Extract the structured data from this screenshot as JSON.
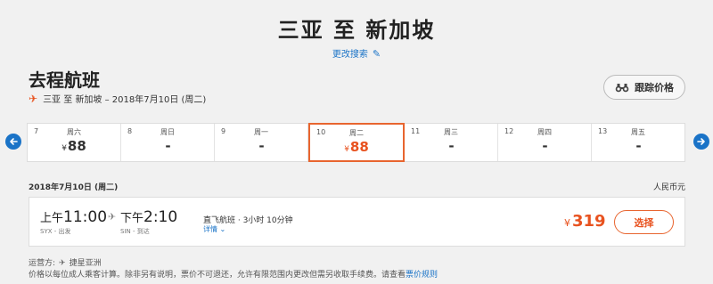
{
  "route": {
    "title": "三亚 至 新加坡",
    "edit_search": "更改搜索"
  },
  "section": {
    "title": "去程航班",
    "from": "三亚",
    "to_word": "至",
    "to": "新加坡",
    "date_text": "– 2018年7月10日 (周二)"
  },
  "track_button": {
    "label": "跟踪价格"
  },
  "date_strip": [
    {
      "day": "7",
      "weekday": "周六",
      "price": "88",
      "currency": "¥"
    },
    {
      "day": "8",
      "weekday": "周日",
      "price": "-",
      "currency": ""
    },
    {
      "day": "9",
      "weekday": "周一",
      "price": "-",
      "currency": ""
    },
    {
      "day": "10",
      "weekday": "周二",
      "price": "88",
      "currency": "¥",
      "selected": true
    },
    {
      "day": "11",
      "weekday": "周三",
      "price": "-",
      "currency": ""
    },
    {
      "day": "12",
      "weekday": "周四",
      "price": "-",
      "currency": ""
    },
    {
      "day": "13",
      "weekday": "周五",
      "price": "-",
      "currency": ""
    }
  ],
  "results": {
    "date_label": "2018年7月10日 (周二)",
    "currency_label": "人民币元"
  },
  "flight": {
    "dep_ampm": "上午",
    "dep_time": "11:00",
    "dep_code": "SYX - 出发",
    "arr_ampm": "下午",
    "arr_time": "2:10",
    "arr_code": "SIN - 到达",
    "info": "直飞航班 · 3小时 10分钟",
    "details": "详情",
    "currency": "¥",
    "price": "319",
    "select_label": "选择"
  },
  "footer": {
    "carrier_label": "运营方:",
    "carrier_name": "捷星亚洲",
    "note": "价格以每位成人乘客计算。除非另有说明，票价不可退还，允许有限范围内更改但需另收取手续费。请查看",
    "note_link": "票价规则"
  },
  "colors": {
    "accent": "#e8521f",
    "link": "#1a73c7"
  }
}
